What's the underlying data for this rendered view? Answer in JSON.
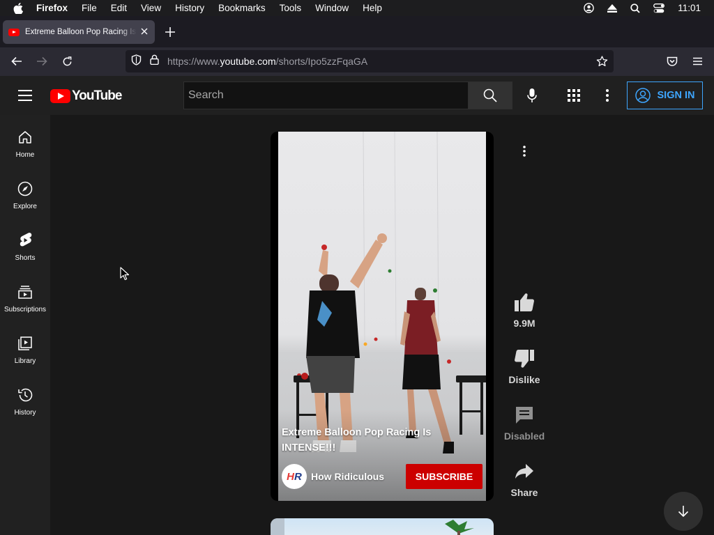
{
  "menubar": {
    "app": "Firefox",
    "items": [
      "File",
      "Edit",
      "View",
      "History",
      "Bookmarks",
      "Tools",
      "Window",
      "Help"
    ],
    "clock": "11:01"
  },
  "browser": {
    "tab_title": "Extreme Balloon Pop Racing Is INTENSE!!! - YouTube",
    "url_prefix": "https://www.",
    "url_host": "youtube.com",
    "url_path": "/shorts/Ipo5zzFqaGA"
  },
  "youtube": {
    "logo_text": "YouTube",
    "search_placeholder": "Search",
    "sign_in": "SIGN IN",
    "sidebar": [
      {
        "label": "Home",
        "icon": "home-icon"
      },
      {
        "label": "Explore",
        "icon": "compass-icon"
      },
      {
        "label": "Shorts",
        "icon": "shorts-icon"
      },
      {
        "label": "Subscriptions",
        "icon": "subscriptions-icon"
      },
      {
        "label": "Library",
        "icon": "library-icon"
      },
      {
        "label": "History",
        "icon": "history-icon"
      }
    ],
    "short": {
      "title": "Extreme Balloon Pop Racing Is INTENSE!!!",
      "channel": "How Ridiculous",
      "channel_avatar_letters": [
        "H",
        "R"
      ],
      "subscribe": "SUBSCRIBE",
      "likes": "9.9M",
      "dislike": "Dislike",
      "comments": "Disabled",
      "share": "Share"
    }
  },
  "colors": {
    "brand_red": "#ff0000",
    "subscribe_red": "#cc0000",
    "link_blue": "#3ea6ff"
  }
}
